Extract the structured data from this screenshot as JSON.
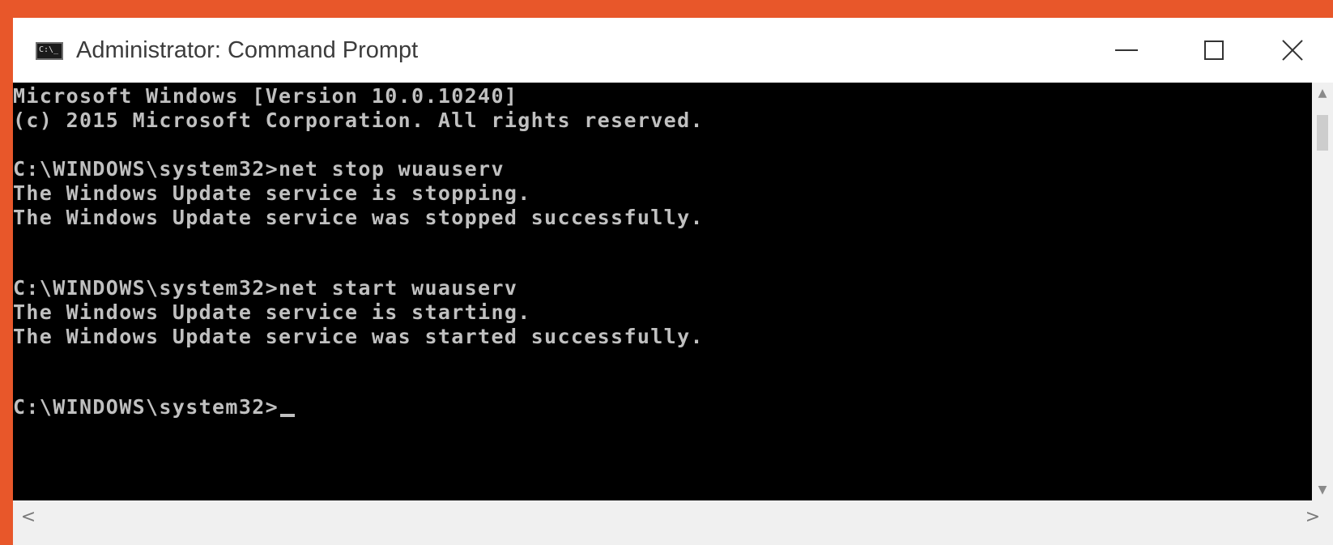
{
  "window": {
    "title": "Administrator: Command Prompt",
    "icon": "command-prompt-icon",
    "icon_text": "C:\\_",
    "controls": {
      "minimize": "minimize-icon",
      "maximize": "maximize-icon",
      "close": "close-icon"
    }
  },
  "console": {
    "lines": [
      "Microsoft Windows [Version 10.0.10240]",
      "(c) 2015 Microsoft Corporation. All rights reserved.",
      "",
      "C:\\WINDOWS\\system32>net stop wuauserv",
      "The Windows Update service is stopping.",
      "The Windows Update service was stopped successfully.",
      "",
      "",
      "C:\\WINDOWS\\system32>net start wuauserv",
      "The Windows Update service is starting.",
      "The Windows Update service was started successfully.",
      "",
      "",
      "C:\\WINDOWS\\system32>"
    ],
    "text_color": "#c0c0c0",
    "background_color": "#000000"
  },
  "scrollbars": {
    "vertical": {
      "up": "▲",
      "down": "▼"
    },
    "horizontal": {
      "left": "<",
      "right": ">"
    }
  },
  "colors": {
    "frame_accent": "#e8572a"
  }
}
